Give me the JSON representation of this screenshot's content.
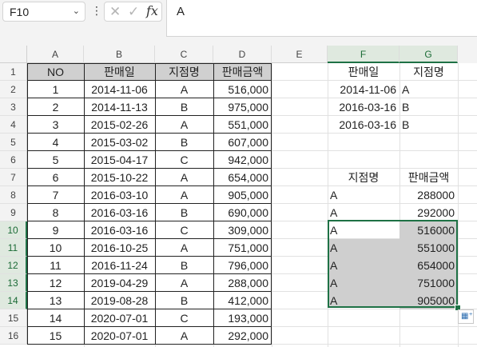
{
  "formula_bar": {
    "name_box": "F10",
    "name_box_arrow": "⌄",
    "more": "⋮",
    "cancel": "✕",
    "confirm": "✓",
    "fx": "fx",
    "value": "A"
  },
  "columns": [
    "A",
    "B",
    "C",
    "D",
    "E",
    "F",
    "G"
  ],
  "rows": [
    "1",
    "2",
    "3",
    "4",
    "5",
    "6",
    "7",
    "8",
    "9",
    "10",
    "11",
    "12",
    "13",
    "14",
    "15",
    "16"
  ],
  "table": {
    "headers": [
      "NO",
      "판매일",
      "지점명",
      "판매금액"
    ],
    "rows": [
      [
        "1",
        "2014-11-06",
        "A",
        "516,000"
      ],
      [
        "2",
        "2014-11-13",
        "B",
        "975,000"
      ],
      [
        "3",
        "2015-02-26",
        "A",
        "551,000"
      ],
      [
        "4",
        "2015-03-02",
        "B",
        "607,000"
      ],
      [
        "5",
        "2015-04-17",
        "C",
        "942,000"
      ],
      [
        "6",
        "2015-10-22",
        "A",
        "654,000"
      ],
      [
        "7",
        "2016-03-10",
        "A",
        "905,000"
      ],
      [
        "8",
        "2016-03-16",
        "B",
        "690,000"
      ],
      [
        "9",
        "2016-03-16",
        "C",
        "309,000"
      ],
      [
        "10",
        "2016-10-25",
        "A",
        "751,000"
      ],
      [
        "11",
        "2016-11-24",
        "B",
        "796,000"
      ],
      [
        "12",
        "2019-04-29",
        "A",
        "288,000"
      ],
      [
        "13",
        "2019-08-28",
        "B",
        "412,000"
      ],
      [
        "14",
        "2020-07-01",
        "C",
        "193,000"
      ],
      [
        "15",
        "2020-07-01",
        "A",
        "292,000"
      ]
    ]
  },
  "criteria": {
    "headers": [
      "판매일",
      "지점명"
    ],
    "rows": [
      [
        "2014-11-06",
        "A"
      ],
      [
        "2016-03-16",
        "B"
      ],
      [
        "2016-03-16",
        "B"
      ]
    ]
  },
  "result": {
    "headers": [
      "지점명",
      "판매금액"
    ],
    "rows": [
      [
        "A",
        "288000"
      ],
      [
        "A",
        "292000"
      ],
      [
        "A",
        "516000"
      ],
      [
        "A",
        "551000"
      ],
      [
        "A",
        "654000"
      ],
      [
        "A",
        "751000"
      ],
      [
        "A",
        "905000"
      ]
    ]
  },
  "selection": {
    "active_cell": "F10",
    "range": "F10:G14",
    "highlight_color": "#cfcfcf",
    "border_color": "#1e7145"
  },
  "quick_analysis_icon": "quick-analysis-icon"
}
